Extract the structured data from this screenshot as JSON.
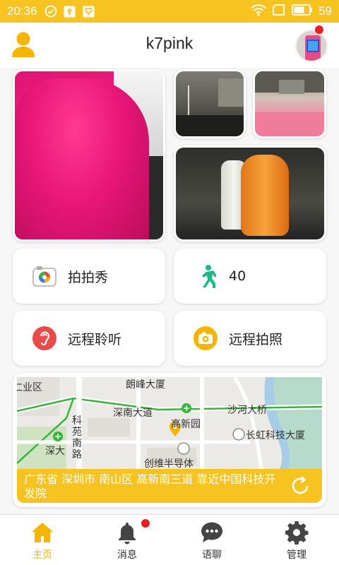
{
  "status_bar": {
    "time": "20:36",
    "battery": "59"
  },
  "header": {
    "title": "k7pink"
  },
  "features": [
    {
      "label": "拍拍秀",
      "icon": "camera-color-icon"
    },
    {
      "label": "40",
      "icon": "running-person-icon"
    },
    {
      "label": "远程聆听",
      "icon": "ear-icon"
    },
    {
      "label": "远程拍照",
      "icon": "remote-camera-icon"
    }
  ],
  "map": {
    "labels": [
      "仁业区",
      "朗峰大厦",
      "深南大道",
      "沙河大桥",
      "高新园",
      "科苑南路",
      "长虹科技大厦",
      "深大",
      "创维半导体"
    ],
    "address": "广东省 深圳市 南山区 高新南三道 靠近中国科技开发院"
  },
  "tabs": [
    {
      "label": "主页",
      "icon": "home-icon"
    },
    {
      "label": "消息",
      "icon": "bell-icon"
    },
    {
      "label": "语聊",
      "icon": "chat-icon"
    },
    {
      "label": "管理",
      "icon": "gear-icon"
    }
  ],
  "colors": {
    "accent": "#f7c320",
    "active_tab": "#f5b400",
    "badge": "#e81e25"
  }
}
